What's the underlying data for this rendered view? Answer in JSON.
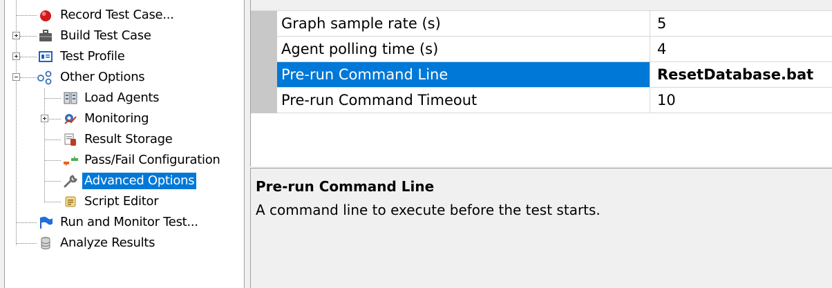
{
  "tree": {
    "items": [
      {
        "label": "Record Test Case..."
      },
      {
        "label": "Build Test Case"
      },
      {
        "label": "Test Profile"
      },
      {
        "label": "Other Options"
      },
      {
        "label": "Load Agents"
      },
      {
        "label": "Monitoring"
      },
      {
        "label": "Result Storage"
      },
      {
        "label": "Pass/Fail Configuration"
      },
      {
        "label": "Advanced Options"
      },
      {
        "label": "Script Editor"
      },
      {
        "label": "Run and Monitor Test..."
      },
      {
        "label": "Analyze Results"
      }
    ],
    "selected_item": "Advanced Options",
    "selection_color": "#0078d7"
  },
  "properties": {
    "rows": [
      {
        "name": "Graph sample rate (s)",
        "value": "5"
      },
      {
        "name": "Agent polling time (s)",
        "value": "4"
      },
      {
        "name": "Pre-run Command Line",
        "value": "ResetDatabase.bat"
      },
      {
        "name": "Pre-run Command Timeout",
        "value": "10"
      }
    ],
    "selected_row": "Pre-run Command Line"
  },
  "description": {
    "title": "Pre-run Command Line",
    "text": "A command line to execute before the test starts."
  }
}
